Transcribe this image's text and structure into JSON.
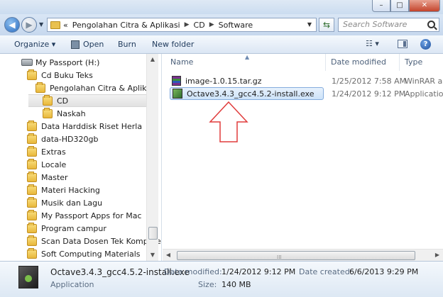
{
  "window": {
    "minimize_symbol": "–",
    "maximize_symbol": "□",
    "close_symbol": "✕"
  },
  "address": {
    "prefix": "«",
    "segments": [
      "Pengolahan Citra & Aplikasi",
      "CD",
      "Software"
    ],
    "separator": "▶"
  },
  "search": {
    "placeholder": "Search Software"
  },
  "toolbar": {
    "organize_label": "Organize ▾",
    "open_label": "Open",
    "burn_label": "Burn",
    "new_folder_label": "New folder",
    "views_label": "☷ ▾",
    "help_label": "?"
  },
  "nav_tree": [
    {
      "label": "My Passport (H:)",
      "kind": "drive",
      "indent": 0,
      "selected": false
    },
    {
      "label": "Cd Buku Teks",
      "kind": "folder",
      "indent": 1,
      "selected": false
    },
    {
      "label": "Pengolahan Citra & Aplikasi",
      "kind": "folder",
      "indent": 2,
      "selected": false
    },
    {
      "label": "CD",
      "kind": "folder",
      "indent": 3,
      "selected": true
    },
    {
      "label": "Naskah",
      "kind": "folder",
      "indent": 3,
      "selected": false
    },
    {
      "label": "Data Harddisk Riset Herla",
      "kind": "folder",
      "indent": 1,
      "selected": false
    },
    {
      "label": "data-HD320gb",
      "kind": "folder",
      "indent": 1,
      "selected": false
    },
    {
      "label": "Extras",
      "kind": "folder",
      "indent": 1,
      "selected": false
    },
    {
      "label": "Locale",
      "kind": "folder",
      "indent": 1,
      "selected": false
    },
    {
      "label": "Master",
      "kind": "folder",
      "indent": 1,
      "selected": false
    },
    {
      "label": "Materi Hacking",
      "kind": "folder",
      "indent": 1,
      "selected": false
    },
    {
      "label": "Musik dan Lagu",
      "kind": "folder",
      "indent": 1,
      "selected": false
    },
    {
      "label": "My Passport Apps for Mac",
      "kind": "folder",
      "indent": 1,
      "selected": false
    },
    {
      "label": "Program campur",
      "kind": "folder",
      "indent": 1,
      "selected": false
    },
    {
      "label": "Scan Data Dosen Tek Komputer",
      "kind": "folder",
      "indent": 1,
      "selected": false
    },
    {
      "label": "Soft Computing Materials",
      "kind": "folder",
      "indent": 1,
      "selected": false
    }
  ],
  "columns": {
    "name": "Name",
    "date": "Date modified",
    "type": "Type"
  },
  "files": [
    {
      "name": "image-1.0.15.tar.gz",
      "date": "1/25/2012 7:58 AM",
      "type": "WinRAR a",
      "icon": "winrar-icon",
      "selected": false
    },
    {
      "name": "Octave3.4.3_gcc4.5.2-install.exe",
      "date": "1/24/2012 9:12 PM",
      "type": "Applicatio",
      "icon": "exe-icon",
      "selected": true
    }
  ],
  "annotation": {
    "arrow_color": "#e03c3c",
    "meaning": "pointer-arrow-icon"
  },
  "details": {
    "file_name": "Octave3.4.3_gcc4.5.2-install.exe",
    "file_type": "Application",
    "date_modified_label": "Date modified:",
    "date_modified_value": "1/24/2012 9:12 PM",
    "date_created_label": "Date created:",
    "date_created_value": "6/6/2013 9:29 PM",
    "size_label": "Size:",
    "size_value": "140 MB"
  }
}
